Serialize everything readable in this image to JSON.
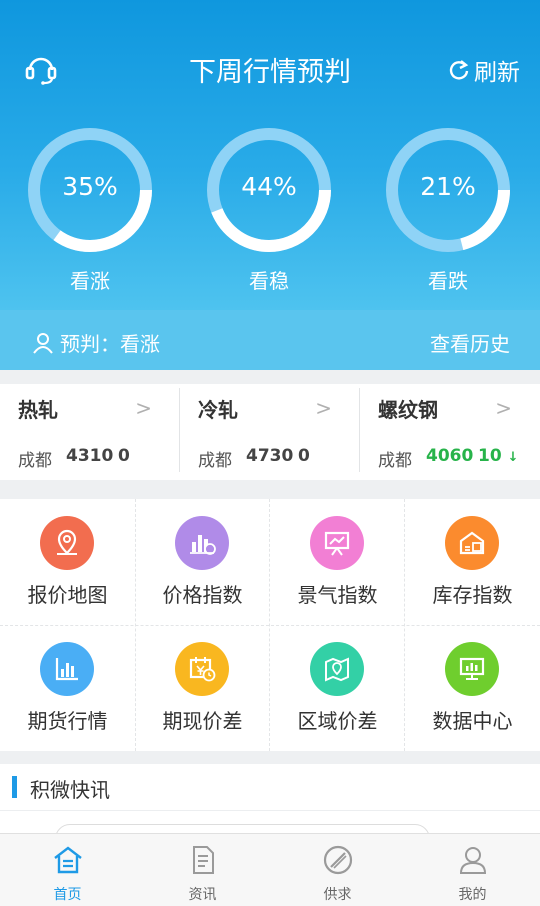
{
  "header": {
    "title": "下周行情预判",
    "refresh_label": "刷新"
  },
  "gauges": [
    {
      "percent_text": "35%",
      "label": "看涨",
      "fraction": 0.35
    },
    {
      "percent_text": "44%",
      "label": "看稳",
      "fraction": 0.44
    },
    {
      "percent_text": "21%",
      "label": "看跌",
      "fraction": 0.21
    }
  ],
  "forecast": {
    "user_label": "预判：看涨",
    "history_label": "查看历史"
  },
  "prices": [
    {
      "name": "热轧",
      "city": "成都",
      "value": "4310",
      "change": "0",
      "trend": "flat"
    },
    {
      "name": "冷轧",
      "city": "成都",
      "value": "4730",
      "change": "0",
      "trend": "flat"
    },
    {
      "name": "螺纹钢",
      "city": "成都",
      "value": "4060",
      "change": "10",
      "trend": "down",
      "arrow": "↓"
    }
  ],
  "grid": [
    {
      "label": "报价地图",
      "icon": "map-pin-icon",
      "color": "#f26d4f"
    },
    {
      "label": "价格指数",
      "icon": "bar-coin-icon",
      "color": "#b08be8"
    },
    {
      "label": "景气指数",
      "icon": "presentation-icon",
      "color": "#f27fd4"
    },
    {
      "label": "库存指数",
      "icon": "warehouse-icon",
      "color": "#fb8b2e"
    },
    {
      "label": "期货行情",
      "icon": "bar-chart-icon",
      "color": "#4aaef5"
    },
    {
      "label": "期现价差",
      "icon": "calendar-clock-icon",
      "color": "#f9b720"
    },
    {
      "label": "区域价差",
      "icon": "map-location-icon",
      "color": "#33d0a6"
    },
    {
      "label": "数据中心",
      "icon": "monitor-chart-icon",
      "color": "#6fce2e"
    }
  ],
  "news": {
    "title": "积微快讯"
  },
  "tabs": [
    {
      "label": "首页",
      "icon": "home-icon",
      "active": true
    },
    {
      "label": "资讯",
      "icon": "document-icon",
      "active": false
    },
    {
      "label": "供求",
      "icon": "no-sign-icon",
      "active": false
    },
    {
      "label": "我的",
      "icon": "user-icon",
      "active": false
    }
  ],
  "colors": {
    "accent": "#1e9ae6",
    "down": "#27b34a"
  }
}
